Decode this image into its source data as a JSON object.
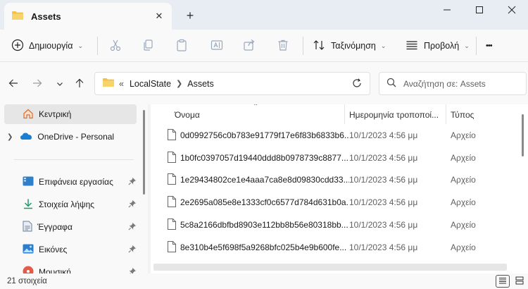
{
  "window": {
    "tab_title": "Assets",
    "new_tab_glyph": "+",
    "close_glyph": "✕"
  },
  "toolbar": {
    "new_label": "Δημιουργία",
    "sort_label": "Ταξινόμηση",
    "view_label": "Προβολή",
    "more_glyph": "•••"
  },
  "address": {
    "overflow": "«",
    "breadcrumb": [
      "LocalState",
      "Assets"
    ],
    "search_placeholder": "Αναζήτηση σε: Assets"
  },
  "sidebar": {
    "items": [
      {
        "label": "Κεντρική",
        "icon": "home-icon",
        "pinned": false
      },
      {
        "label": "OneDrive - Personal",
        "icon": "onedrive-icon",
        "pinned": false
      },
      {
        "label": "Επιφάνεια εργασίας",
        "icon": "desktop-icon",
        "pinned": true
      },
      {
        "label": "Στοιχεία λήψης",
        "icon": "download-icon",
        "pinned": true
      },
      {
        "label": "Έγγραφα",
        "icon": "documents-icon",
        "pinned": true
      },
      {
        "label": "Εικόνες",
        "icon": "pictures-icon",
        "pinned": true
      },
      {
        "label": "Μουσική",
        "icon": "music-icon",
        "pinned": true
      }
    ]
  },
  "columns": {
    "name": "Όνομα",
    "date": "Ημερομηνία τροποποί...",
    "type": "Τύπος"
  },
  "files": [
    {
      "name": "0d0992756c0b783e91779f17e6f83b6833b6...",
      "date": "10/1/2023 4:56 μμ",
      "type": "Αρχείο"
    },
    {
      "name": "1b0fc0397057d19440ddd8b0978739c8877...",
      "date": "10/1/2023 4:56 μμ",
      "type": "Αρχείο"
    },
    {
      "name": "1e29434802ce1e4aaa7ca8e8d09830cdd33...",
      "date": "10/1/2023 4:56 μμ",
      "type": "Αρχείο"
    },
    {
      "name": "2e2695a085e8e1333cf0c6577d784d631b0a...",
      "date": "10/1/2023 4:56 μμ",
      "type": "Αρχείο"
    },
    {
      "name": "5c8a2166dbfbd8903e112bb8b56e80318bb...",
      "date": "10/1/2023 4:56 μμ",
      "type": "Αρχείο"
    },
    {
      "name": "8e310b4e5f698f5a9268bfc025b4e9b600fe...",
      "date": "10/1/2023 4:56 μμ",
      "type": "Αρχείο"
    }
  ],
  "status": {
    "count": "21 στοιχεία"
  },
  "colors": {
    "accent": "#0067c0",
    "folder": "#f2c14e",
    "titlebar": "#e8edf3"
  }
}
